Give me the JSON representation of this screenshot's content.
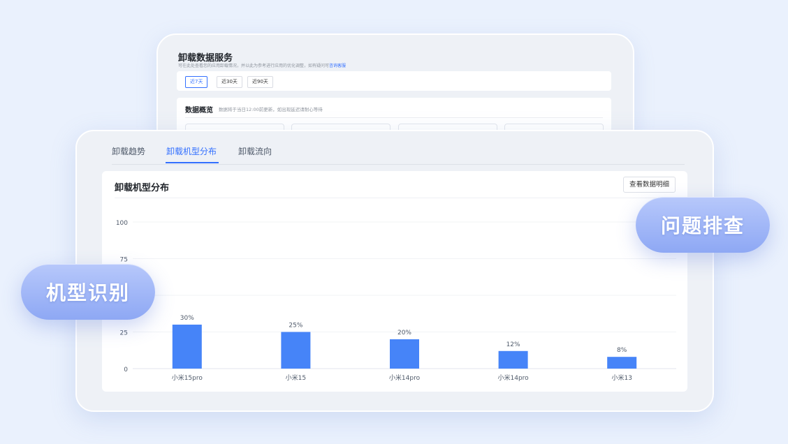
{
  "service": {
    "title": "卸载数据服务",
    "desc": "可在此处查看您的应用卸载情况，并以此为参考进行应用的优化调整，如有疑问可",
    "desc_link": "咨询客服",
    "ranges": [
      "近7天",
      "近30天",
      "近90天"
    ],
    "active_range": "近7天",
    "overview_title": "数据概览",
    "overview_desc": "数据将于当日12:00前更新，如出现延迟请耐心等待"
  },
  "tabs": [
    {
      "label": "卸载趋势",
      "active": false
    },
    {
      "label": "卸载机型分布",
      "active": true
    },
    {
      "label": "卸载流向",
      "active": false
    }
  ],
  "panel": {
    "title": "卸载机型分布",
    "detail_button": "查看数据明细"
  },
  "chart_data": {
    "type": "bar",
    "categories": [
      "小米15pro",
      "小米15",
      "小米14pro",
      "小米14pro",
      "小米13"
    ],
    "values": [
      30,
      25,
      20,
      12,
      8
    ],
    "data_labels": [
      "30%",
      "25%",
      "20%",
      "12%",
      "8%"
    ],
    "yticks": [
      0,
      25,
      75,
      100
    ],
    "ylim": [
      0,
      100
    ],
    "grid": true,
    "bar_color": "#4684f8"
  },
  "badges": {
    "model_identify": "机型识别",
    "troubleshoot": "问题排查"
  },
  "colors": {
    "accent": "#3370ff",
    "background": "#eaf1fd",
    "pill": "#9fb5f7"
  }
}
